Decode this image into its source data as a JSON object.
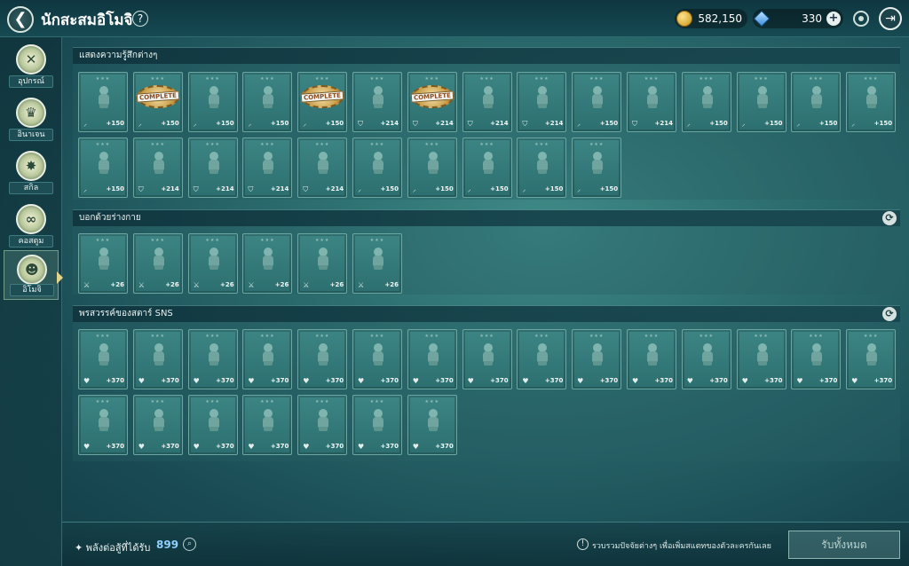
{
  "header": {
    "title": "นักสะสมอิโมจิ",
    "help": "?",
    "gold": "582,150",
    "gems": "330",
    "plus": "+"
  },
  "sidebar": {
    "items": [
      {
        "label": "อุปกรณ์",
        "icon": "tools-icon"
      },
      {
        "label": "อินาเจน",
        "icon": "crown-icon"
      },
      {
        "label": "สกิล",
        "icon": "star-burst-icon"
      },
      {
        "label": "คอสตูม",
        "icon": "mask-icon"
      },
      {
        "label": "อิโมจิ",
        "icon": "emoji-face-icon"
      }
    ],
    "active_index": 4
  },
  "sections": [
    {
      "title": "แสดงความรู้สึกต่างๆ",
      "has_refresh": false,
      "cards": [
        {
          "icon": "sword-icon",
          "value": "+150",
          "complete": false
        },
        {
          "icon": "sword-icon",
          "value": "+150",
          "complete": true
        },
        {
          "icon": "sword-icon",
          "value": "+150",
          "complete": false
        },
        {
          "icon": "sword-icon",
          "value": "+150",
          "complete": false
        },
        {
          "icon": "sword-icon",
          "value": "+150",
          "complete": true
        },
        {
          "icon": "shield-icon",
          "value": "+214",
          "complete": false
        },
        {
          "icon": "shield-icon",
          "value": "+214",
          "complete": true
        },
        {
          "icon": "shield-icon",
          "value": "+214",
          "complete": false
        },
        {
          "icon": "shield-icon",
          "value": "+214",
          "complete": false
        },
        {
          "icon": "sword-icon",
          "value": "+150",
          "complete": false
        },
        {
          "icon": "shield-icon",
          "value": "+214",
          "complete": false
        },
        {
          "icon": "sword-icon",
          "value": "+150",
          "complete": false
        },
        {
          "icon": "sword-icon",
          "value": "+150",
          "complete": false
        },
        {
          "icon": "sword-icon",
          "value": "+150",
          "complete": false
        },
        {
          "icon": "sword-icon",
          "value": "+150",
          "complete": false
        },
        {
          "icon": "sword-icon",
          "value": "+150",
          "complete": false
        },
        {
          "icon": "shield-icon",
          "value": "+214",
          "complete": false
        },
        {
          "icon": "shield-icon",
          "value": "+214",
          "complete": false
        },
        {
          "icon": "shield-icon",
          "value": "+214",
          "complete": false
        },
        {
          "icon": "shield-icon",
          "value": "+214",
          "complete": false
        },
        {
          "icon": "sword-icon",
          "value": "+150",
          "complete": false
        },
        {
          "icon": "sword-icon",
          "value": "+150",
          "complete": false
        },
        {
          "icon": "sword-icon",
          "value": "+150",
          "complete": false
        },
        {
          "icon": "sword-icon",
          "value": "+150",
          "complete": false
        },
        {
          "icon": "sword-icon",
          "value": "+150",
          "complete": false
        }
      ]
    },
    {
      "title": "บอกด้วยร่างกาย",
      "has_refresh": true,
      "cards": [
        {
          "icon": "crossed-swords-icon",
          "value": "+26",
          "complete": false
        },
        {
          "icon": "crossed-swords-icon",
          "value": "+26",
          "complete": false
        },
        {
          "icon": "crossed-swords-icon",
          "value": "+26",
          "complete": false
        },
        {
          "icon": "crossed-swords-icon",
          "value": "+26",
          "complete": false
        },
        {
          "icon": "crossed-swords-icon",
          "value": "+26",
          "complete": false
        },
        {
          "icon": "crossed-swords-icon",
          "value": "+26",
          "complete": false
        }
      ]
    },
    {
      "title": "พรสวรรค์ของสตาร์ SNS",
      "has_refresh": true,
      "cards": [
        {
          "icon": "heart-icon",
          "value": "+370",
          "complete": false
        },
        {
          "icon": "heart-icon",
          "value": "+370",
          "complete": false
        },
        {
          "icon": "heart-icon",
          "value": "+370",
          "complete": false
        },
        {
          "icon": "heart-icon",
          "value": "+370",
          "complete": false
        },
        {
          "icon": "heart-icon",
          "value": "+370",
          "complete": false
        },
        {
          "icon": "heart-icon",
          "value": "+370",
          "complete": false
        },
        {
          "icon": "heart-icon",
          "value": "+370",
          "complete": false
        },
        {
          "icon": "heart-icon",
          "value": "+370",
          "complete": false
        },
        {
          "icon": "heart-icon",
          "value": "+370",
          "complete": false
        },
        {
          "icon": "heart-icon",
          "value": "+370",
          "complete": false
        },
        {
          "icon": "heart-icon",
          "value": "+370",
          "complete": false
        },
        {
          "icon": "heart-icon",
          "value": "+370",
          "complete": false
        },
        {
          "icon": "heart-icon",
          "value": "+370",
          "complete": false
        },
        {
          "icon": "heart-icon",
          "value": "+370",
          "complete": false
        },
        {
          "icon": "heart-icon",
          "value": "+370",
          "complete": false
        },
        {
          "icon": "heart-icon",
          "value": "+370",
          "complete": false
        },
        {
          "icon": "heart-icon",
          "value": "+370",
          "complete": false
        },
        {
          "icon": "heart-icon",
          "value": "+370",
          "complete": false
        },
        {
          "icon": "heart-icon",
          "value": "+370",
          "complete": false
        },
        {
          "icon": "heart-icon",
          "value": "+370",
          "complete": false
        },
        {
          "icon": "heart-icon",
          "value": "+370",
          "complete": false
        },
        {
          "icon": "heart-icon",
          "value": "+370",
          "complete": false
        }
      ]
    }
  ],
  "complete_label": "COMPLETE",
  "footer": {
    "power_label": "พลังต่อสู้ที่ได้รับ",
    "power_value": "899",
    "hint_icon": "!",
    "hint": "รวบรวมปัจจัยต่างๆ เพื่อเพิ่มสแตทของตัวละครกันเลย",
    "claim_all": "รับทั้งหมด"
  },
  "colors": {
    "accent": "#8fd0ff",
    "card_bg": "#3c8584",
    "header_bg": "#0f3640"
  }
}
